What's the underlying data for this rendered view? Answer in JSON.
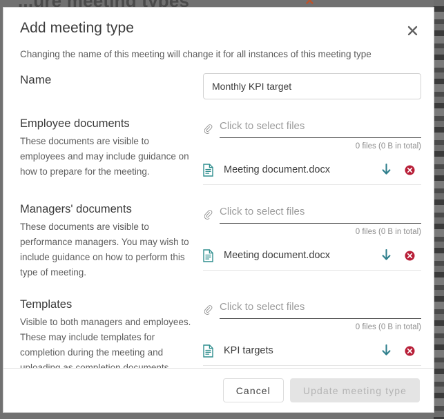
{
  "backdrop": {
    "page_title": "...ure meeting types",
    "page_close_icon": "×"
  },
  "modal": {
    "title": "Add meeting type",
    "close_icon": "✕",
    "subtitle": "Changing the name of this meeting will change it for all instances of this meeting type",
    "name_field": {
      "label": "Name",
      "value": "Monthly KPI target",
      "placeholder": ""
    },
    "sections": [
      {
        "title": "Employee documents",
        "description": "These documents are visible to employees and may include guidance on how to prepare for the meeting.",
        "upload_placeholder": "Click to select files",
        "file_meta": "0 files (0 B in total)",
        "files": [
          {
            "name": "Meeting document.docx",
            "download_icon": "download-arrow",
            "delete_icon": "remove-circle"
          }
        ]
      },
      {
        "title": "Managers' documents",
        "description": "These documents are visible to performance managers. You may wish to include guidance on how to perform this type of meeting.",
        "upload_placeholder": "Click to select files",
        "file_meta": "0 files (0 B in total)",
        "files": [
          {
            "name": "Meeting document.docx",
            "download_icon": "download-arrow",
            "delete_icon": "remove-circle"
          }
        ]
      },
      {
        "title": "Templates",
        "description": "Visible to both managers and employees. These may include templates for completion during the meeting and uploading as completion documents.",
        "upload_placeholder": "Click to select files",
        "file_meta": "0 files (0 B in total)",
        "files": [
          {
            "name": "KPI targets",
            "download_icon": "download-arrow",
            "delete_icon": "remove-circle"
          }
        ]
      }
    ],
    "footer": {
      "cancel_label": "Cancel",
      "submit_label": "Update meeting type"
    }
  },
  "colors": {
    "teal": "#2a8a8a",
    "delete_red": "#b81f38",
    "text_dark": "#3b3b3b",
    "text_muted": "#8c8c8c",
    "disabled_bg": "#e4e4e4"
  }
}
